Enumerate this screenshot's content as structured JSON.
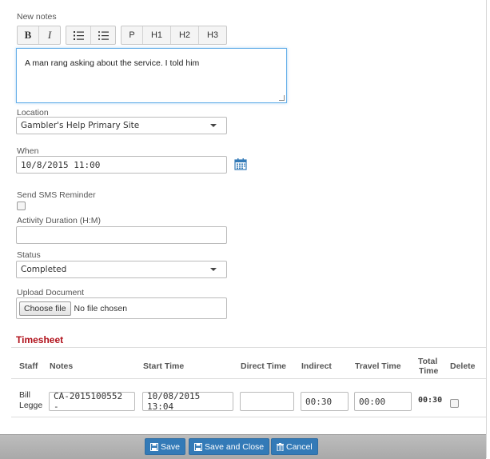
{
  "notes": {
    "label": "New notes",
    "toolbar": {
      "bold": "B",
      "italic": "I",
      "p": "P",
      "h1": "H1",
      "h2": "H2",
      "h3": "H3"
    },
    "content": "A man rang asking about the service. I told him"
  },
  "location": {
    "label": "Location",
    "value": "Gambler's Help Primary Site"
  },
  "when": {
    "label": "When",
    "value": "10/8/2015 11:00"
  },
  "sms": {
    "label": "Send SMS Reminder",
    "checked": false
  },
  "duration": {
    "label": "Activity Duration (H:M)",
    "value": ""
  },
  "status": {
    "label": "Status",
    "value": "Completed"
  },
  "upload": {
    "label": "Upload Document",
    "button": "Choose file",
    "status": "No file chosen"
  },
  "timesheet": {
    "title": "Timesheet",
    "headers": {
      "staff": "Staff",
      "notes": "Notes",
      "start": "Start Time",
      "direct": "Direct Time",
      "indirect": "Indirect",
      "travel": "Travel Time",
      "total_1": "Total",
      "total_2": "Time",
      "delete": "Delete"
    },
    "row": {
      "staff_1": "Bill",
      "staff_2": "Legge",
      "notes": "CA-2015100552 -",
      "start": "10/08/2015 13:04",
      "direct": "",
      "indirect": "00:30",
      "travel": "00:00",
      "total": "00:30"
    }
  },
  "footer": {
    "save": "Save",
    "save_close": "Save and Close",
    "cancel": "Cancel"
  },
  "colors": {
    "accent": "#337ab7",
    "section": "#b0101a"
  }
}
